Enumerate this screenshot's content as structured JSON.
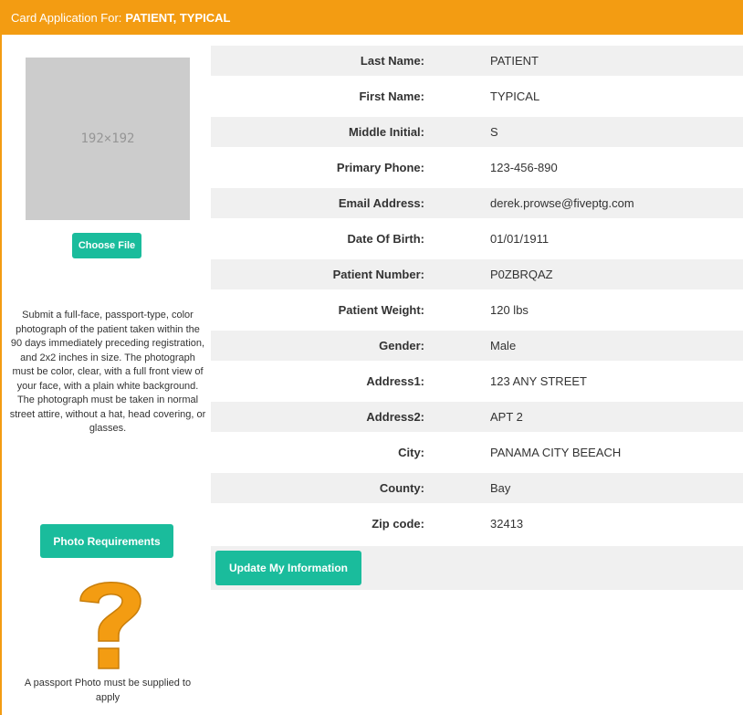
{
  "header": {
    "label": "Card Application For:",
    "patient_name": "PATIENT, TYPICAL",
    "bg_color": "#f39c12"
  },
  "photo": {
    "placeholder_text": "192×192"
  },
  "buttons": {
    "choose_file": "Choose File",
    "photo_requirements": "Photo Requirements",
    "update": "Update My Information",
    "accent_color": "#1abc9c"
  },
  "instructions": "Submit a full-face, passport-type, color photograph of the patient taken within the 90 days immediately preceding registration, and 2x2 inches in size. The photograph must be color, clear, with a full front view of your face, with a plain white background. The photograph must be taken in normal street attire, without a hat, head covering, or glasses.",
  "passport_note": "A passport Photo must be supplied to apply",
  "question_icon": "question-mark-icon",
  "fields": [
    {
      "label": "Last Name:",
      "value": "PATIENT"
    },
    {
      "label": "First Name:",
      "value": "TYPICAL"
    },
    {
      "label": "Middle Initial:",
      "value": "S"
    },
    {
      "label": "Primary Phone:",
      "value": "123-456-890"
    },
    {
      "label": "Email Address:",
      "value": "derek.prowse@fiveptg.com"
    },
    {
      "label": "Date Of Birth:",
      "value": "01/01/1911"
    },
    {
      "label": "Patient Number:",
      "value": "P0ZBRQAZ"
    },
    {
      "label": "Patient Weight:",
      "value": "120 lbs"
    },
    {
      "label": "Gender:",
      "value": "Male"
    },
    {
      "label": "Address1:",
      "value": "123 ANY STREET"
    },
    {
      "label": "Address2:",
      "value": "APT 2"
    },
    {
      "label": "City:",
      "value": "PANAMA CITY BEEACH"
    },
    {
      "label": "County:",
      "value": "Bay"
    },
    {
      "label": "Zip code:",
      "value": "32413"
    }
  ]
}
